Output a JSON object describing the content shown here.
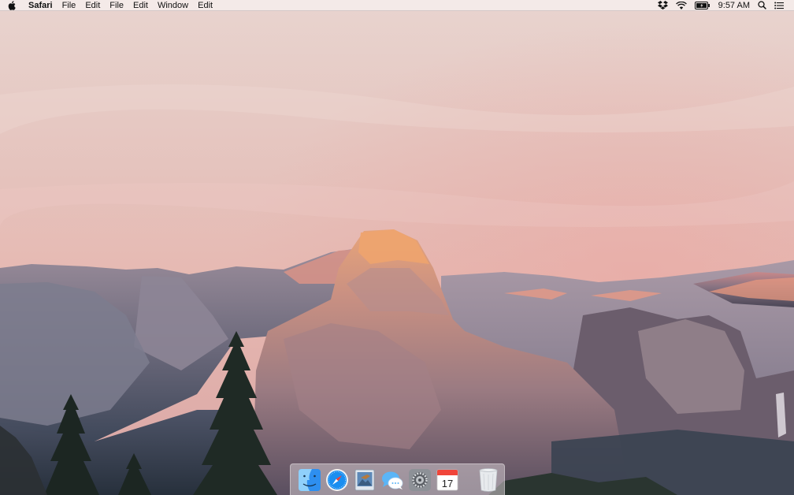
{
  "menubar": {
    "apple_icon": "apple-logo-icon",
    "app_name": "Safari",
    "items": [
      {
        "label": "File"
      },
      {
        "label": "Edit"
      },
      {
        "label": "File"
      },
      {
        "label": "Edit"
      },
      {
        "label": "Window"
      },
      {
        "label": "Edit"
      }
    ],
    "status": {
      "icons": [
        "dropbox-icon",
        "wifi-icon",
        "battery-icon",
        "spotlight-search-icon",
        "notification-center-icon"
      ],
      "time": "9:57 AM"
    }
  },
  "desktop": {
    "wallpaper": "Yosemite Half Dome at dusk"
  },
  "dock": {
    "apps": [
      {
        "name": "Finder",
        "icon": "finder-icon"
      },
      {
        "name": "Safari",
        "icon": "safari-icon"
      },
      {
        "name": "Preview",
        "icon": "preview-icon"
      },
      {
        "name": "Messages",
        "icon": "messages-icon"
      },
      {
        "name": "System Preferences",
        "icon": "system-preferences-icon"
      },
      {
        "name": "Calendar",
        "icon": "calendar-icon",
        "badge_day": "17"
      }
    ],
    "trash": {
      "name": "Trash",
      "icon": "trash-icon"
    }
  },
  "colors": {
    "sky_top": "#e5c8c4",
    "sky_bottom": "#e7b9b0",
    "rock_light": "#d69a88",
    "rock_dark": "#6d5e6d",
    "valley_shadow": "#3b4656"
  }
}
